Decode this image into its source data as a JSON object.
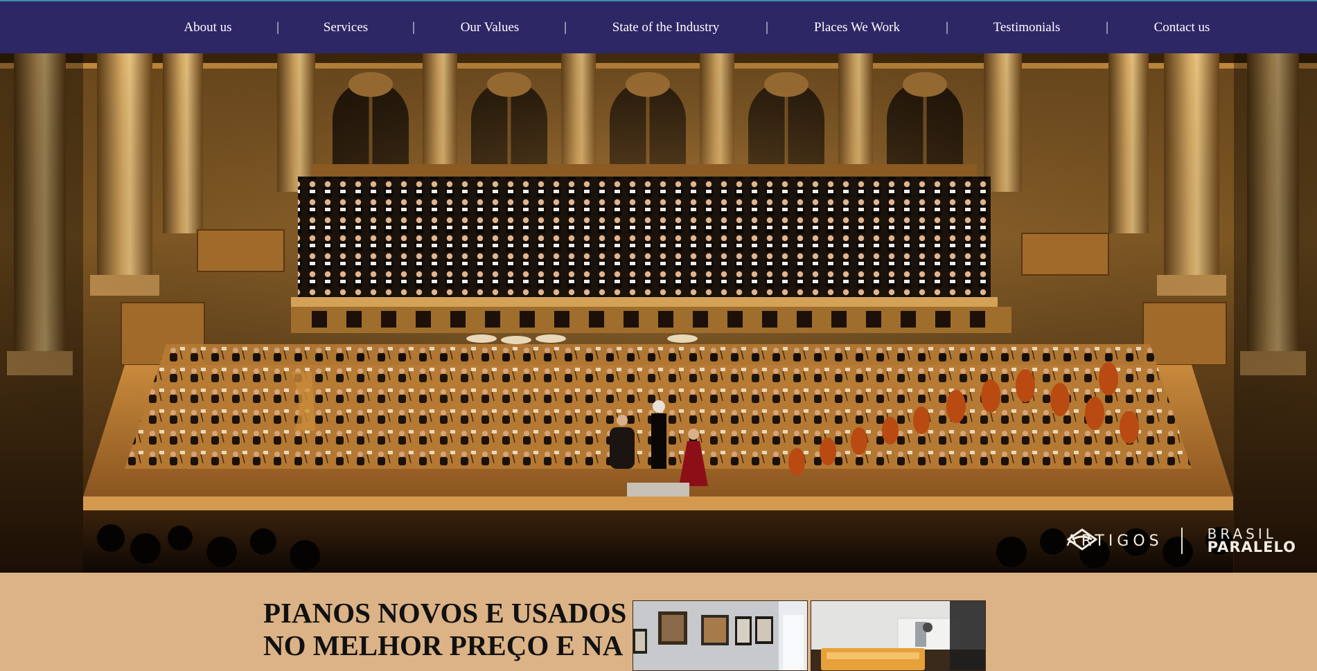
{
  "nav": {
    "items": [
      {
        "label": "About us"
      },
      {
        "label": "Services"
      },
      {
        "label": "Our Values"
      },
      {
        "label": "State of the Industry"
      },
      {
        "label": "Places We Work"
      },
      {
        "label": "Testimonials"
      },
      {
        "label": "Contact us"
      }
    ],
    "separator": "|"
  },
  "hero": {
    "watermark_section": "ARTIGOS",
    "watermark_brand_top": "BRASIL",
    "watermark_brand_bottom": "PARALELO"
  },
  "content": {
    "headline": "PIANOS NOVOS E USADOS NO MELHOR PREÇO E NA"
  },
  "colors": {
    "nav_bg": "#2d2766",
    "page_bg": "#dcb386",
    "text_dark": "#111111"
  }
}
